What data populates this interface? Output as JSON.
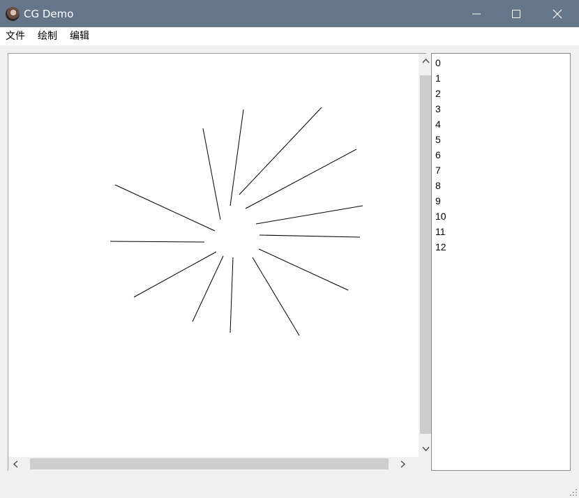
{
  "window": {
    "title": "CG Demo"
  },
  "menu": {
    "items": [
      "文件",
      "绘制",
      "编辑"
    ]
  },
  "canvas": {
    "line_color": "#000000",
    "lines": [
      [
        349,
        157,
        330,
        295
      ],
      [
        461,
        154,
        343,
        279
      ],
      [
        511,
        214,
        352,
        299
      ],
      [
        520,
        295,
        367,
        321
      ],
      [
        516,
        340,
        372,
        337
      ],
      [
        499,
        416,
        371,
        357
      ],
      [
        429,
        481,
        362,
        369
      ],
      [
        334,
        369,
        330,
        477
      ],
      [
        320,
        367,
        276,
        461
      ],
      [
        310,
        361,
        192,
        426
      ],
      [
        293,
        347,
        158,
        346
      ],
      [
        308,
        331,
        165,
        265
      ],
      [
        316,
        315,
        291,
        184
      ]
    ]
  },
  "list": {
    "items": [
      "0",
      "1",
      "2",
      "3",
      "4",
      "5",
      "6",
      "7",
      "8",
      "9",
      "10",
      "11",
      "12"
    ]
  }
}
